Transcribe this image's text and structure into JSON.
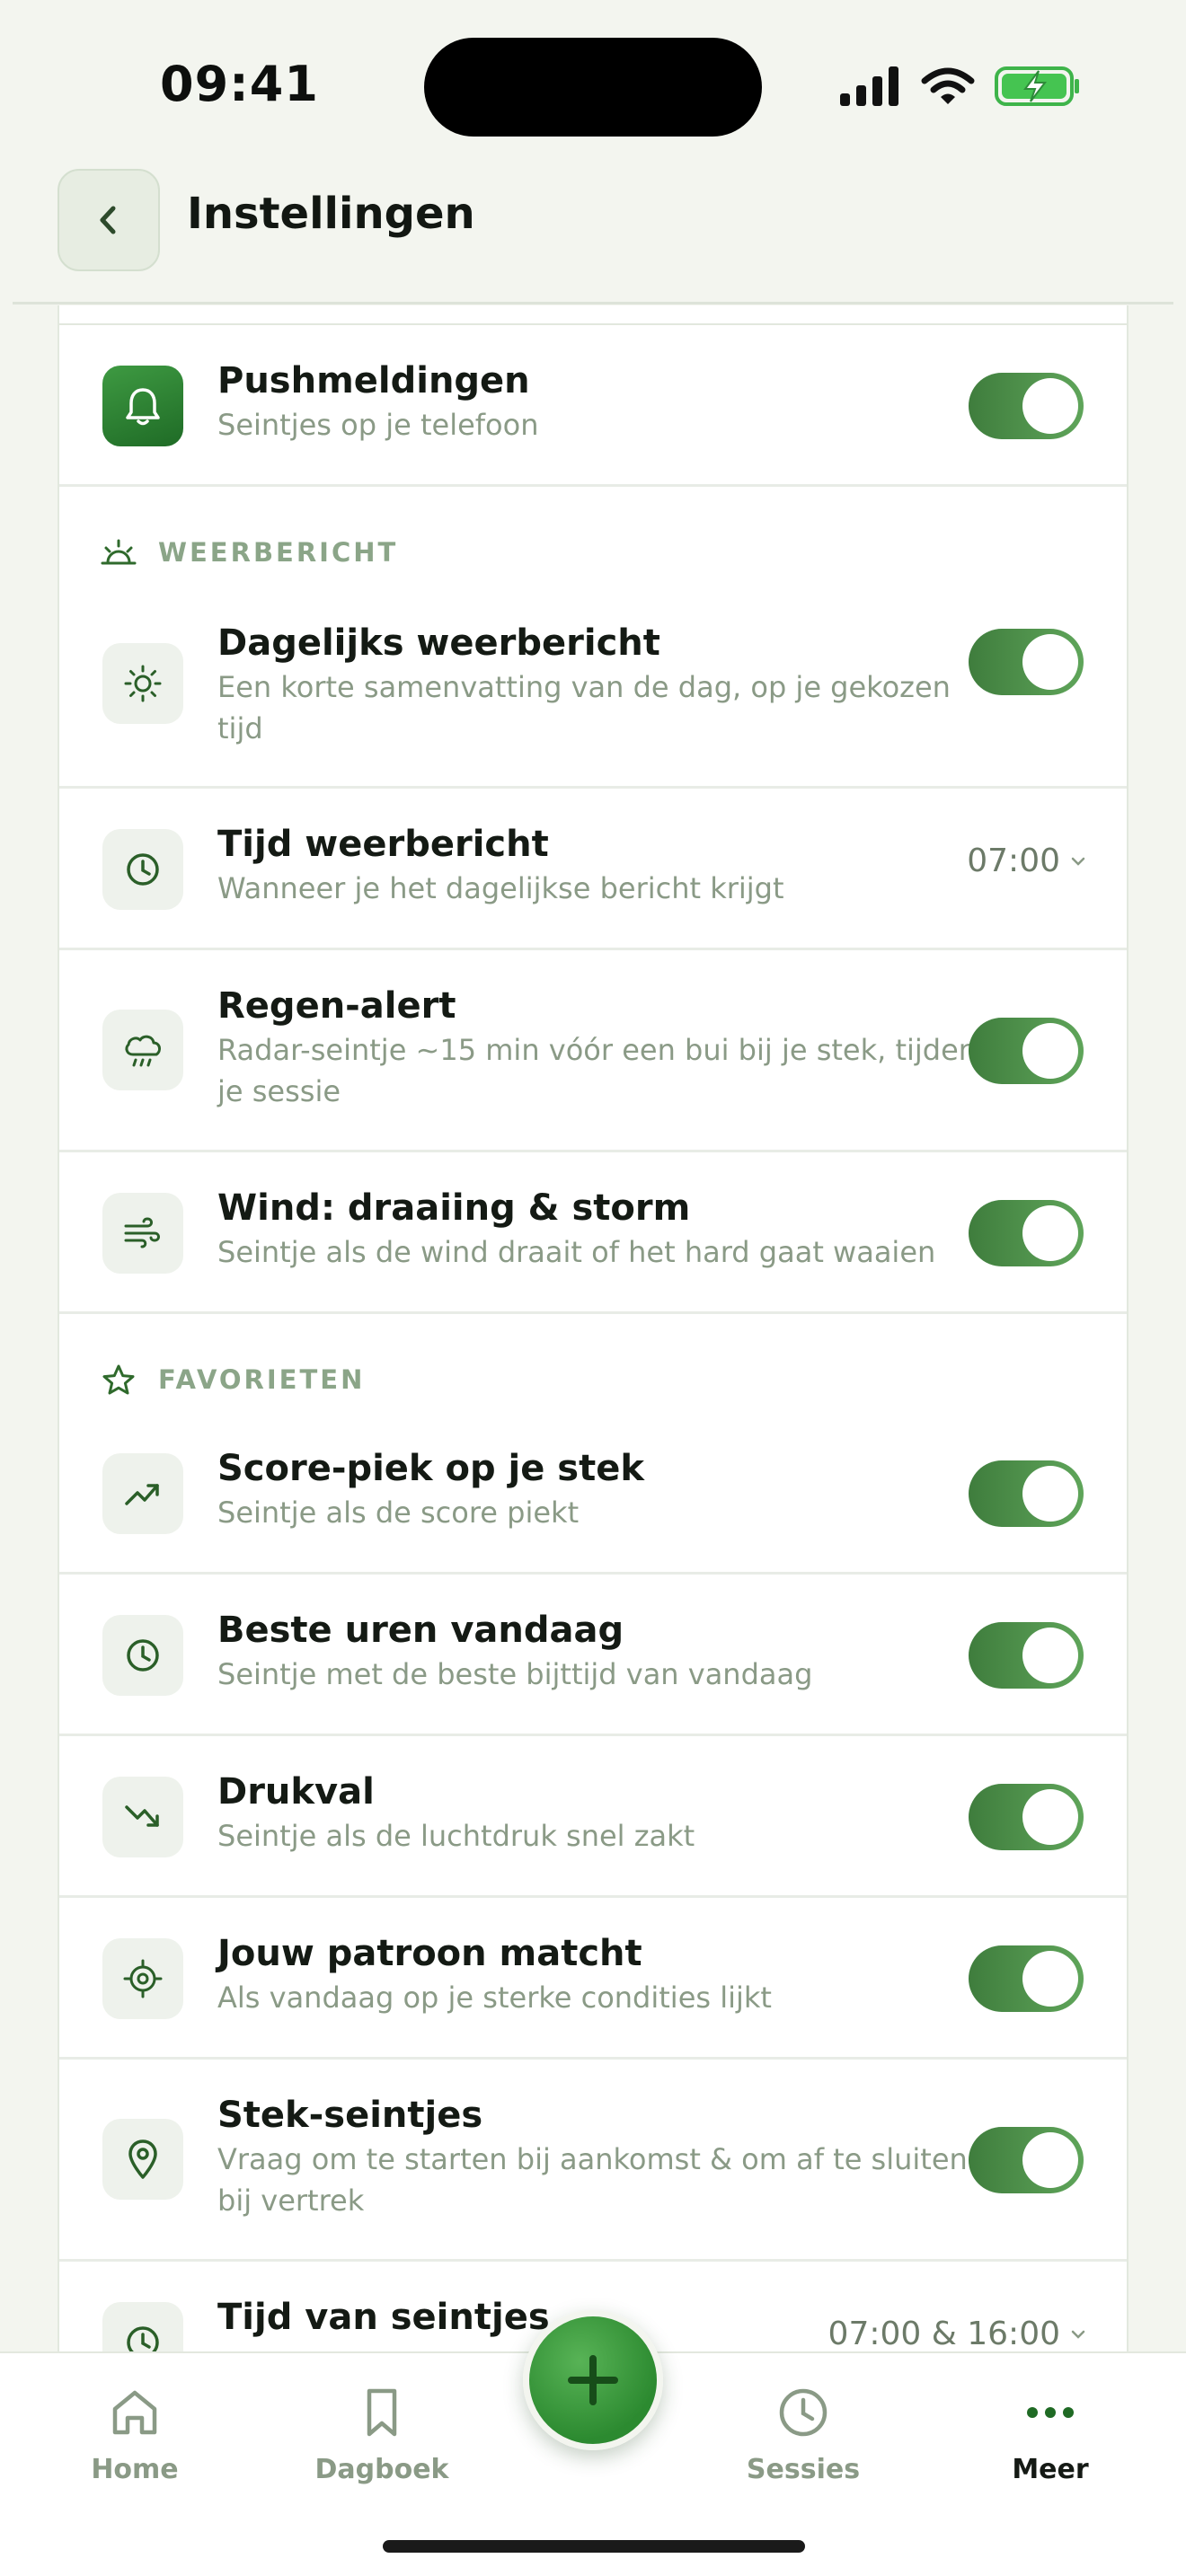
{
  "status_bar": {
    "time": "09:41"
  },
  "header": {
    "title": "Instellingen"
  },
  "push": {
    "title": "Pushmeldingen",
    "subtitle": "Seintjes op je telefoon",
    "enabled": true
  },
  "sections": {
    "weather": {
      "label": "WEERBERICHT"
    },
    "favorites": {
      "label": "FAVORIETEN"
    }
  },
  "weather_rows": [
    {
      "title": "Dagelijks weerbericht",
      "subtitle": "Een korte samenvatting van de dag, op je gekozen tijd",
      "enabled": true,
      "icon": "sun-icon"
    },
    {
      "title": "Tijd weerbericht",
      "subtitle": "Wanneer je het dagelijkse bericht krijgt",
      "value": "07:00",
      "icon": "clock-icon"
    },
    {
      "title": "Regen-alert",
      "subtitle": "Radar-seintje ~15 min vóór een bui bij je stek, tijdens je sessie",
      "enabled": true,
      "icon": "rain-cloud-icon"
    },
    {
      "title": "Wind: draaiing & storm",
      "subtitle": "Seintje als de wind draait of het hard gaat waaien",
      "enabled": true,
      "icon": "wind-icon"
    }
  ],
  "favorite_rows": [
    {
      "title": "Score-piek op je stek",
      "subtitle": "Seintje als de score piekt",
      "enabled": true,
      "icon": "trend-up-icon"
    },
    {
      "title": "Beste uren vandaag",
      "subtitle": "Seintje met de beste bijttijd van vandaag",
      "enabled": true,
      "icon": "clock-icon"
    },
    {
      "title": "Drukval",
      "subtitle": "Seintje als de luchtdruk snel zakt",
      "enabled": true,
      "icon": "trend-down-icon"
    },
    {
      "title": "Jouw patroon matcht",
      "subtitle": "Als vandaag op je sterke condities lijkt",
      "enabled": true,
      "icon": "target-icon"
    },
    {
      "title": "Stek-seintjes",
      "subtitle": "Vraag om te starten bij aankomst & om af te sluiten bij vertrek",
      "enabled": true,
      "icon": "location-pin-icon"
    },
    {
      "title": "Tijd van seintjes",
      "value": "07:00 & 16:00",
      "icon": "clock-icon"
    }
  ],
  "nav": {
    "home": "Home",
    "journal": "Dagboek",
    "sessions": "Sessies",
    "more": "Meer",
    "active": "more"
  },
  "colors": {
    "accent": "#3f8a3d",
    "muted_text": "#8a9a86",
    "background": "#f3f5ef"
  }
}
